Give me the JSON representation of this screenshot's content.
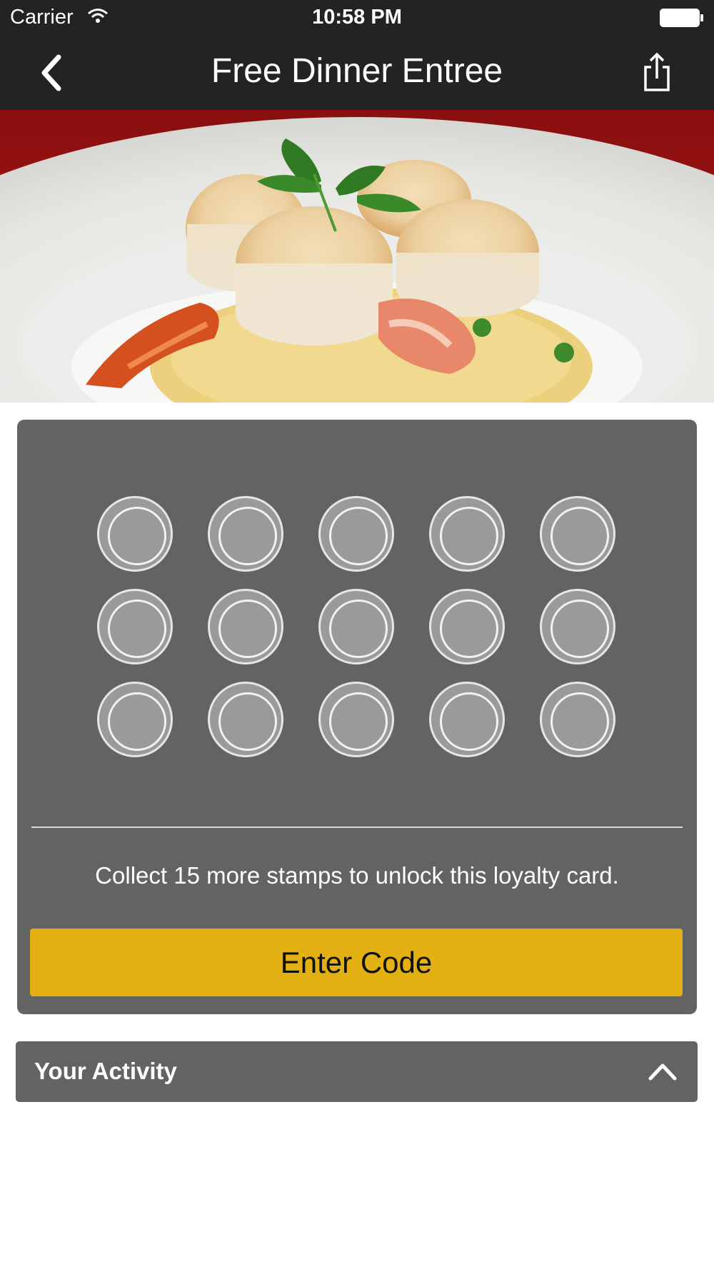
{
  "status_bar": {
    "carrier": "Carrier",
    "time": "10:58 PM"
  },
  "nav": {
    "title": "Free Dinner Entree",
    "back_icon": "chevron-left-icon",
    "share_icon": "share-icon"
  },
  "hero": {
    "image": "dish-photo"
  },
  "loyalty_card": {
    "total_stamps": 15,
    "collected_stamps": 0,
    "message": "Collect 15 more stamps to unlock this loyalty card.",
    "button_label": "Enter Code"
  },
  "activity": {
    "title": "Your Activity",
    "toggle_icon": "chevron-up-icon"
  },
  "colors": {
    "top_bar": "#232323",
    "card_bg": "#636363",
    "stamp_fill": "#9a9a9a",
    "button": "#e3b013"
  }
}
